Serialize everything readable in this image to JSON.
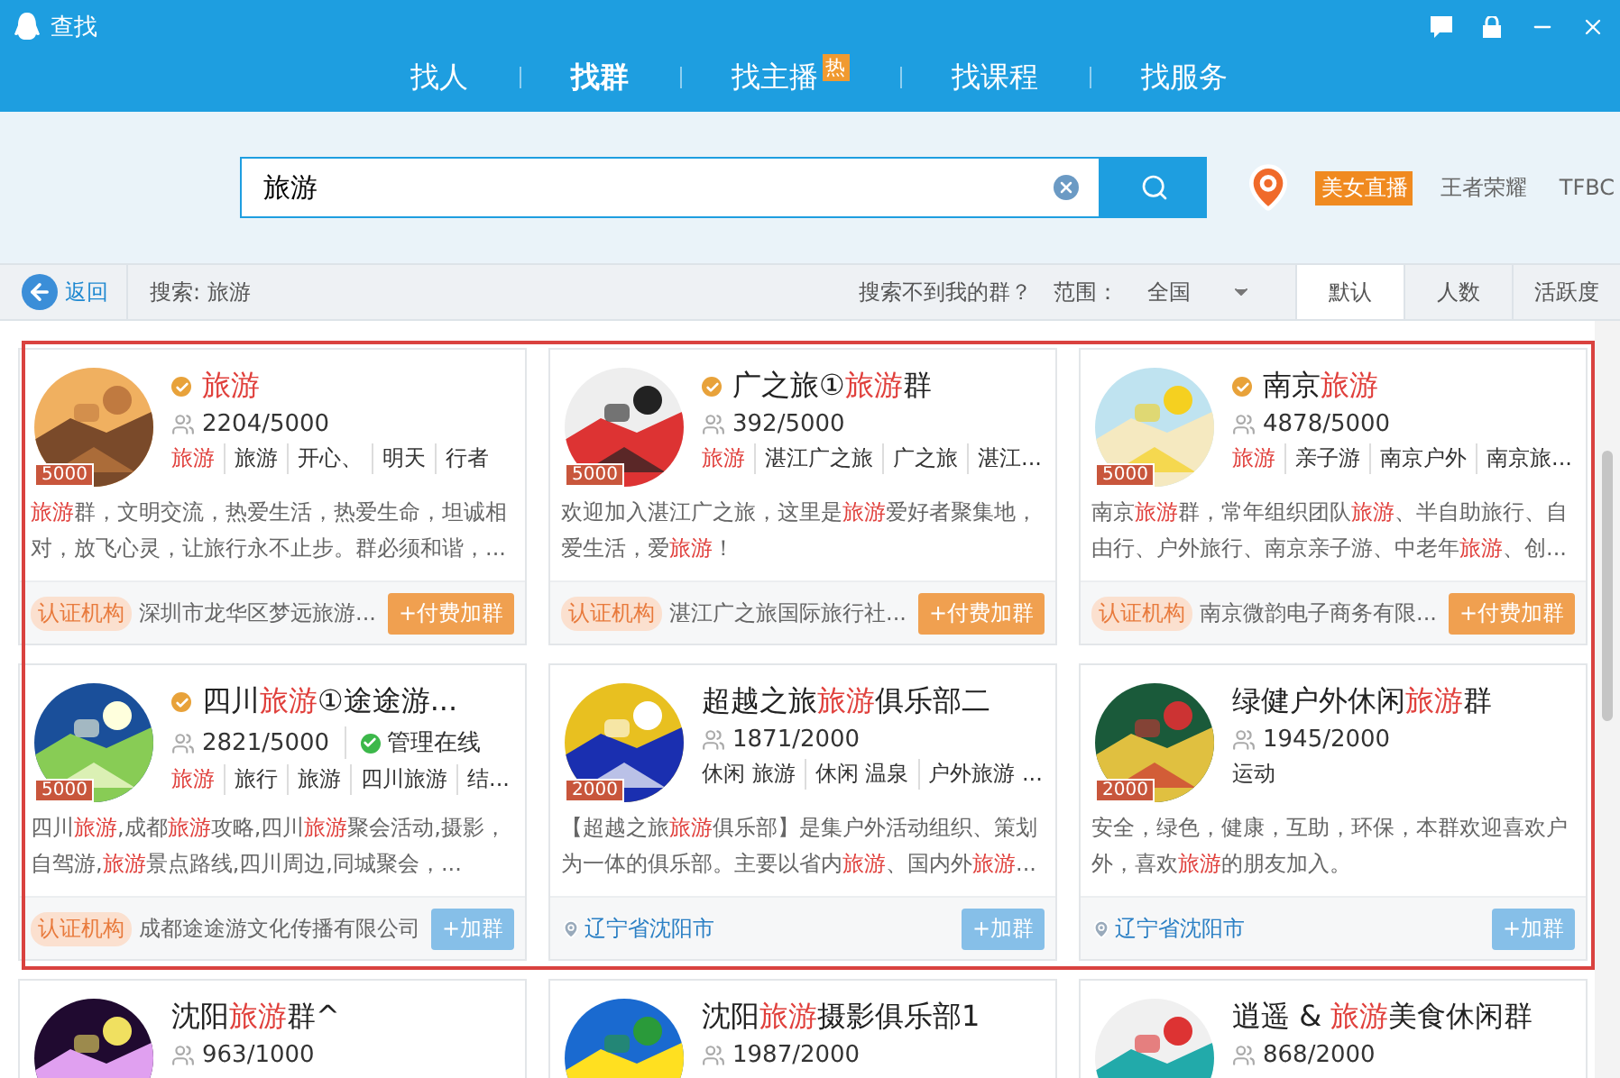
{
  "window": {
    "title": "查找"
  },
  "nav_tabs": [
    {
      "label": "找人",
      "selected": false
    },
    {
      "label": "找群",
      "selected": true
    },
    {
      "label": "找主播",
      "selected": false,
      "badge": "热"
    },
    {
      "label": "找课程",
      "selected": false
    },
    {
      "label": "找服务",
      "selected": false
    }
  ],
  "search": {
    "value": "旅游"
  },
  "hot_links": [
    {
      "label": "美女直播",
      "kind": "badge"
    },
    {
      "label": "王者荣耀",
      "kind": "plain"
    },
    {
      "label": "TFBC",
      "kind": "plain"
    }
  ],
  "toolbar": {
    "back": "返回",
    "query": "搜索: 旅游",
    "help_link": "搜索不到我的群？",
    "scope_label": "范围：",
    "scope_value": "全国"
  },
  "sort_tabs": [
    {
      "label": "默认",
      "selected": true
    },
    {
      "label": "人数",
      "selected": false
    },
    {
      "label": "活跃度",
      "selected": false
    }
  ],
  "annotation_frame": true,
  "groups": [
    {
      "name": "**旅游**",
      "verified": true,
      "level_badge": "5000",
      "members": "2204/5000",
      "tags": [
        "**旅游**",
        "旅游",
        "开心、",
        "明天",
        "行者"
      ],
      "description": "**旅游**群，文明交流，热爱生活，热爱生命，坦诚相对，放飞心灵，让旅行永不止步。群必须和谐，...",
      "footer": {
        "kind": "org",
        "badge": "认证机构",
        "text": "深圳市龙华区梦远旅游..."
      },
      "button": {
        "kind": "paid",
        "label": "+付费加群"
      }
    },
    {
      "name": "广之旅①**旅游**群",
      "verified": true,
      "level_badge": "5000",
      "members": "392/5000",
      "tags": [
        "**旅游**",
        "湛江广之旅",
        "广之旅",
        "湛江..."
      ],
      "description": "欢迎加入湛江广之旅，这里是**旅游**爱好者聚集地，爱生活，爱**旅游**！",
      "footer": {
        "kind": "org",
        "badge": "认证机构",
        "text": "湛江广之旅国际旅行社..."
      },
      "button": {
        "kind": "paid",
        "label": "+付费加群"
      }
    },
    {
      "name": "南京**旅游**",
      "verified": true,
      "level_badge": "5000",
      "members": "4878/5000",
      "tags": [
        "**旅游**",
        "亲子游",
        "南京户外",
        "南京旅..."
      ],
      "description": "南京**旅游**群，常年组织团队**旅游**、半自助旅行、自由行、户外旅行、南京亲子游、中老年**旅游**、创...",
      "footer": {
        "kind": "org",
        "badge": "认证机构",
        "text": "南京微韵电子商务有限..."
      },
      "button": {
        "kind": "paid",
        "label": "+付费加群"
      }
    },
    {
      "name": "四川**旅游**①途途游...",
      "verified": true,
      "level_badge": "5000",
      "members": "2821/5000",
      "admin_online": "管理在线",
      "tags": [
        "**旅游**",
        "旅行",
        "旅游",
        "四川旅游",
        "结..."
      ],
      "description": "四川**旅游**,成都**旅游**攻略,四川**旅游**聚会活动,摄影，自驾游,**旅游**景点路线,四川周边,同城聚会，...",
      "footer": {
        "kind": "org",
        "badge": "认证机构",
        "text": "成都途途游文化传播有限公司"
      },
      "button": {
        "kind": "join",
        "label": "+加群"
      }
    },
    {
      "name": "超越之旅**旅游**俱乐部二",
      "verified": false,
      "level_badge": "2000",
      "members": "1871/2000",
      "tags": [
        "休闲 旅游",
        "休闲 温泉",
        "户外旅游 ..."
      ],
      "description": "【超越之旅**旅游**俱乐部】是集户外活动组织、策划为一体的俱乐部。主要以省内**旅游**、国内外**旅游**...",
      "footer": {
        "kind": "location",
        "text": "辽宁省沈阳市"
      },
      "button": {
        "kind": "join",
        "label": "+加群"
      }
    },
    {
      "name": "绿健户外休闲**旅游**群",
      "verified": false,
      "level_badge": "2000",
      "members": "1945/2000",
      "tags": [
        "运动"
      ],
      "description": "安全，绿色，健康，互助，环保，本群欢迎喜欢户外，喜欢**旅游**的朋友加入。",
      "footer": {
        "kind": "location",
        "text": "辽宁省沈阳市"
      },
      "button": {
        "kind": "join",
        "label": "+加群"
      }
    },
    {
      "name": "沈阳**旅游**群^",
      "verified": false,
      "members": "963/1000"
    },
    {
      "name": "沈阳**旅游**摄影俱乐部1",
      "verified": false,
      "members": "1987/2000"
    },
    {
      "name": "逍遥 & **旅游**美食休闲群",
      "verified": false,
      "members": "868/2000"
    }
  ]
}
